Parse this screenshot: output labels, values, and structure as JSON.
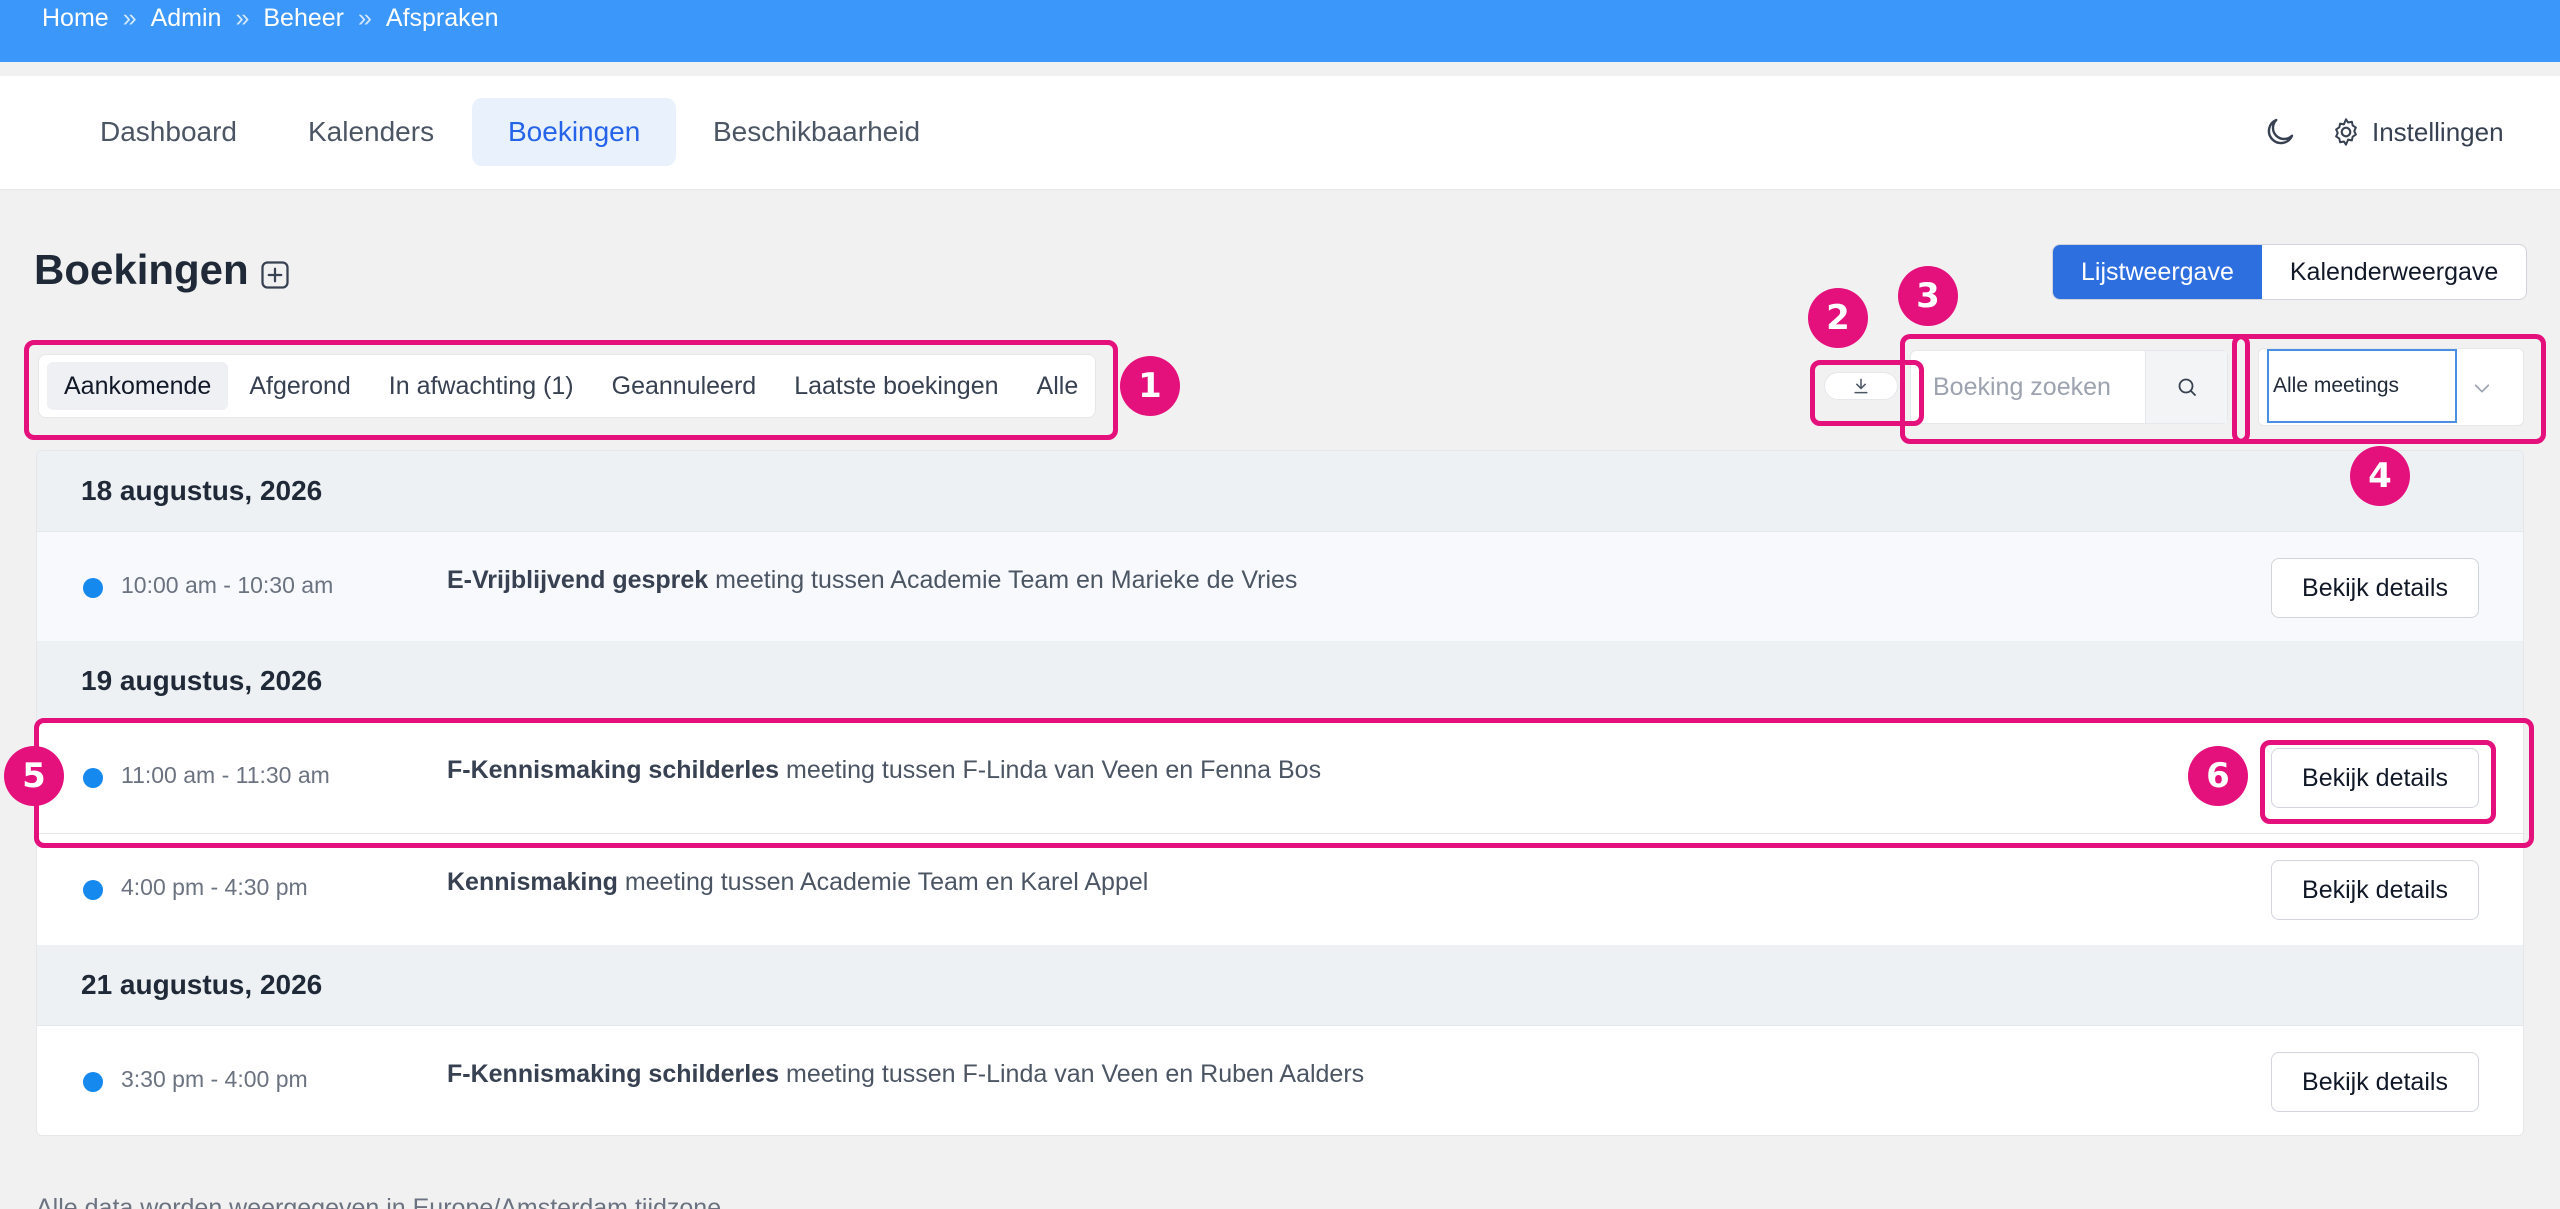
{
  "breadcrumb": {
    "items": [
      "Home",
      "Admin",
      "Beheer",
      "Afspraken"
    ],
    "separator": "»"
  },
  "nav": {
    "tabs": [
      "Dashboard",
      "Kalenders",
      "Boekingen",
      "Beschikbaarheid"
    ],
    "active_tab": "Boekingen",
    "settings_label": "Instellingen",
    "icons": [
      "moon-icon",
      "gear-icon"
    ]
  },
  "page": {
    "title": "Boekingen"
  },
  "view_toggle": {
    "list": "Lijstweergave",
    "calendar": "Kalenderweergave",
    "active": "Lijstweergave"
  },
  "filters": {
    "tabs": [
      "Aankomende",
      "Afgerond",
      "In afwachting (1)",
      "Geannuleerd",
      "Laatste boekingen",
      "Alle"
    ],
    "active": "Aankomende"
  },
  "search": {
    "placeholder": "Boeking zoeken",
    "value": ""
  },
  "meeting_select": {
    "selected": "Alle meetings"
  },
  "groups": [
    {
      "date": "18 augustus, 2026",
      "bookings": [
        {
          "time": "10:00 am - 10:30 am",
          "title": "E-Vrijblijvend gesprek",
          "details": "meeting tussen Academie Team en Marieke de Vries",
          "button": "Bekijk details"
        }
      ]
    },
    {
      "date": "19 augustus, 2026",
      "bookings": [
        {
          "time": "11:00 am - 11:30 am",
          "title": "F-Kennismaking schilderles",
          "details": "meeting tussen F-Linda van Veen en Fenna Bos",
          "button": "Bekijk details"
        },
        {
          "time": "4:00 pm - 4:30 pm",
          "title": "Kennismaking",
          "details": "meeting tussen Academie Team en Karel Appel",
          "button": "Bekijk details"
        }
      ]
    },
    {
      "date": "21 augustus, 2026",
      "bookings": [
        {
          "time": "3:30 pm - 4:00 pm",
          "title": "F-Kennismaking schilderles",
          "details": "meeting tussen F-Linda van Veen en Ruben Aalders",
          "button": "Bekijk details"
        }
      ]
    }
  ],
  "footer": {
    "text": "Alle data worden weergegeven in Europe/Amsterdam tijdzone"
  },
  "annotations": [
    "1",
    "2",
    "3",
    "4",
    "5",
    "6"
  ],
  "colors": {
    "topbar": "#3b97f9",
    "accent": "#2e6fe0",
    "status_dot": "#1589ee",
    "annotation": "#e4107c"
  }
}
